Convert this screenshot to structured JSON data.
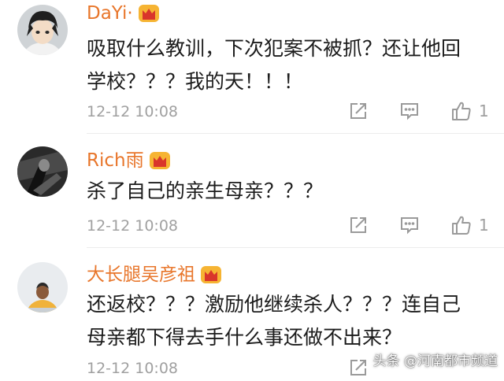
{
  "colors": {
    "username": "#e8762b",
    "text": "#1c1c1c",
    "meta": "#a0a0a0",
    "badge": "#f2a01c"
  },
  "comments": [
    {
      "username": "DaYi·",
      "text": "吸取什么教训，下次犯案不被抓？还让他回\n学校？？？我的天！！！",
      "time": "12-12 10:08",
      "likes": "1",
      "icons": [
        "share-icon",
        "comment-icon",
        "thumbs-up-icon"
      ]
    },
    {
      "username": "Rich雨",
      "text": "杀了自己的亲生母亲？？？",
      "time": "12-12 10:08",
      "likes": "1",
      "icons": [
        "share-icon",
        "comment-icon",
        "thumbs-up-icon"
      ]
    },
    {
      "username": "大长腿吴彦祖",
      "text": "还返校？？？激励他继续杀人？？？连自己\n母亲都下得去手什么事还做不出来？",
      "time": "12-12 10:08",
      "likes": "",
      "icons": [
        "share-icon",
        "comment-icon",
        "thumbs-up-icon"
      ]
    }
  ],
  "watermark": "头条 @河南都市频道"
}
